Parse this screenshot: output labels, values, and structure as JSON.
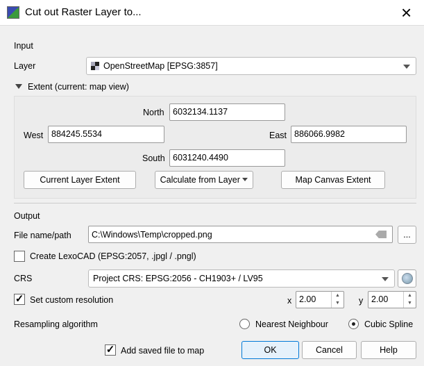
{
  "window": {
    "title": "Cut out Raster Layer to...",
    "close_icon": "×"
  },
  "input": {
    "section": "Input",
    "layer_label": "Layer",
    "layer_value": "OpenStreetMap [EPSG:3857]"
  },
  "extent": {
    "header": "Extent (current: map view)",
    "north_label": "North",
    "north": "6032134.1137",
    "west_label": "West",
    "west": "884245.5534",
    "east_label": "East",
    "east": "886066.9982",
    "south_label": "South",
    "south": "6031240.4490",
    "current_layer_btn": "Current Layer Extent",
    "calculate_btn": "Calculate from Layer",
    "map_canvas_btn": "Map Canvas Extent"
  },
  "output": {
    "section": "Output",
    "file_label": "File name/path",
    "file_value": "C:\\Windows\\Temp\\cropped.png",
    "browse": "...",
    "lexocad_label": "Create LexoCAD (EPSG:2057, .jpgl / .pngl)",
    "lexocad_checked": false,
    "crs_label": "CRS",
    "crs_value": "Project CRS: EPSG:2056 - CH1903+ / LV95",
    "custom_res_label": "Set custom resolution",
    "custom_res_checked": true,
    "x_label": "x",
    "x_value": "2.00",
    "y_label": "y",
    "y_value": "2.00",
    "resampling_label": "Resampling algorithm",
    "nearest_label": "Nearest Neighbour",
    "cubic_label": "Cubic Spline",
    "selected": "Cubic Spline"
  },
  "footer": {
    "add_to_map_label": "Add saved file to map",
    "add_to_map_checked": true,
    "ok": "OK",
    "cancel": "Cancel",
    "help": "Help"
  },
  "check_mark": "✓"
}
